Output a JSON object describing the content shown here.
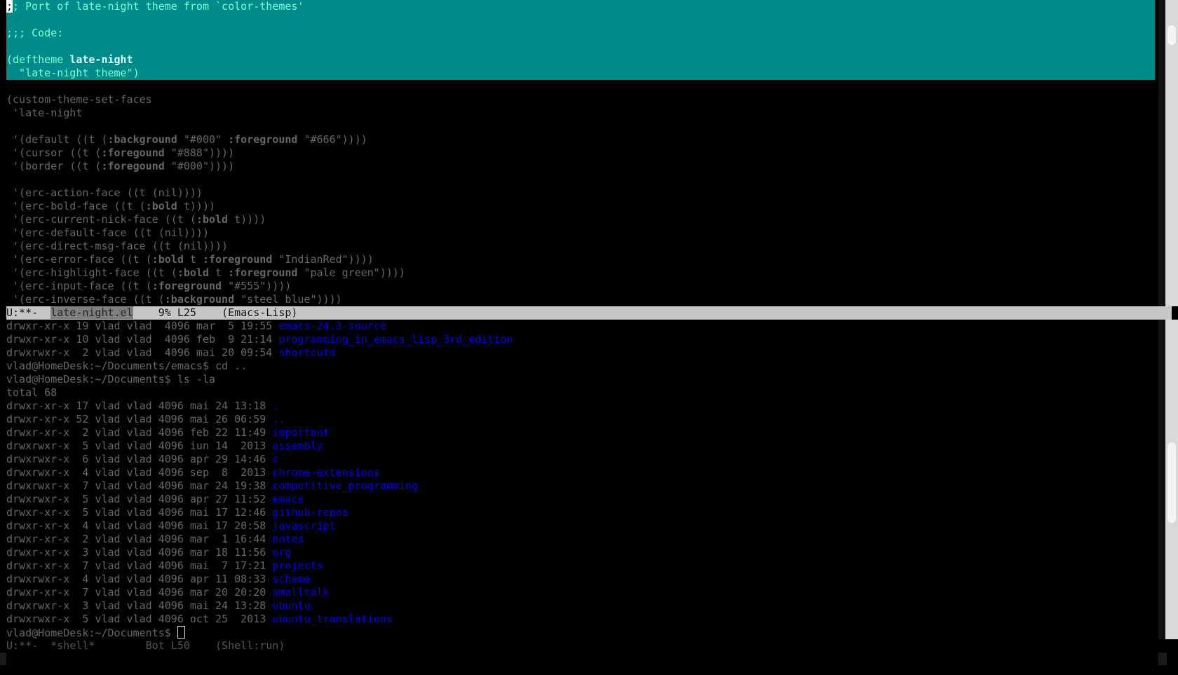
{
  "editor": {
    "selection_lines": {
      "l1_rest": "; Port of late-night theme from `color-themes'",
      "l1_point": ";",
      "l2": ";;; Code:",
      "l3_pre": "(deftheme ",
      "l3_name": "late-night",
      "l4": "  \"late-night theme\")"
    },
    "code": {
      "c1": "(custom-theme-set-faces",
      "c2": " 'late-night",
      "c3_a": " '(default ((t (",
      "c3_k1": ":background",
      "c3_b": " \"#000\" ",
      "c3_k2": ":foreground",
      "c3_c": " \"#666\"))))",
      "c4_a": " '(cursor ((t (",
      "c4_k": ":foregound",
      "c4_b": " \"#888\"))))",
      "c5_a": " '(border ((t (",
      "c5_k": ":foregound",
      "c5_b": " \"#000\"))))",
      "c6": " '(erc-action-face ((t (nil))))",
      "c7_a": " '(erc-bold-face ((t (",
      "c7_k": ":bold",
      "c7_b": " t))))",
      "c8_a": " '(erc-current-nick-face ((t (",
      "c8_k": ":bold",
      "c8_b": " t))))",
      "c9": " '(erc-default-face ((t (nil))))",
      "c10": " '(erc-direct-msg-face ((t (nil))))",
      "c11_a": " '(erc-error-face ((t (",
      "c11_k1": ":bold",
      "c11_b": " t ",
      "c11_k2": ":foreground",
      "c11_c": " \"IndianRed\"))))",
      "c12_a": " '(erc-highlight-face ((t (",
      "c12_k1": ":bold",
      "c12_b": " t ",
      "c12_k2": ":foreground",
      "c12_c": " \"pale green\"))))",
      "c13_a": " '(erc-input-face ((t (",
      "c13_k": ":foreground",
      "c13_b": " \"#555\"))))",
      "c14_a": " '(erc-inverse-face ((t (",
      "c14_k": ":background",
      "c14_b": " \"steel blue\"))))"
    },
    "modeline": {
      "state": "U:**-  ",
      "buffer": "late-night.el",
      "rest": "    9% L25    (Emacs-Lisp)"
    }
  },
  "shell": {
    "lines": [
      {
        "meta": "drwxr-xr-x 19 vlad vlad  4096 mar  5 19:55 ",
        "name": "emacs-24.3-source"
      },
      {
        "meta": "drwxr-xr-x 10 vlad vlad  4096 feb  9 21:14 ",
        "name": "programming_in_emacs_lisp_3rd_edition"
      },
      {
        "meta": "drwxrwxr-x  2 vlad vlad  4096 mai 20 09:54 ",
        "name": "shortcuts"
      }
    ],
    "cmd1": "vlad@HomeDesk:~/Documents/emacs$ cd ..",
    "cmd2": "vlad@HomeDesk:~/Documents$ ls -la",
    "total": "total 68",
    "listing": [
      {
        "meta": "drwxr-xr-x 17 vlad vlad 4096 mai 24 13:18 ",
        "name": "."
      },
      {
        "meta": "drwxr-xr-x 52 vlad vlad 4096 mai 26 06:59 ",
        "name": ".."
      },
      {
        "meta": "drwxr-xr-x  2 vlad vlad 4096 feb 22 11:49 ",
        "name": "important"
      },
      {
        "meta": "drwxrwxr-x  5 vlad vlad 4096 iun 14  2013 ",
        "name": "assembly"
      },
      {
        "meta": "drwxrwxr-x  6 vlad vlad 4096 apr 29 14:46 ",
        "name": "c"
      },
      {
        "meta": "drwxrwxr-x  4 vlad vlad 4096 sep  8  2013 ",
        "name": "chrome-extensions"
      },
      {
        "meta": "drwxrwxr-x  7 vlad vlad 4096 mar 24 19:38 ",
        "name": "competitive_programming"
      },
      {
        "meta": "drwxrwxr-x  5 vlad vlad 4096 apr 27 11:52 ",
        "name": "emacs"
      },
      {
        "meta": "drwxr-xr-x  5 vlad vlad 4096 mai 17 12:46 ",
        "name": "github-repos"
      },
      {
        "meta": "drwxr-xr-x  4 vlad vlad 4096 mai 17 20:58 ",
        "name": "javascript"
      },
      {
        "meta": "drwxr-xr-x  2 vlad vlad 4096 mar  1 16:44 ",
        "name": "notes"
      },
      {
        "meta": "drwxr-xr-x  3 vlad vlad 4096 mar 18 11:56 ",
        "name": "org"
      },
      {
        "meta": "drwxr-xr-x  7 vlad vlad 4096 mai  7 17:21 ",
        "name": "projects"
      },
      {
        "meta": "drwxrwxr-x  4 vlad vlad 4096 apr 11 08:33 ",
        "name": "scheme"
      },
      {
        "meta": "drwxr-xr-x  7 vlad vlad 4096 mar 20 20:20 ",
        "name": "smalltalk"
      },
      {
        "meta": "drwxrwxr-x  3 vlad vlad 4096 mai 24 13:28 ",
        "name": "ubuntu"
      },
      {
        "meta": "drwxrwxr-x  5 vlad vlad 4096 oct 25  2013 ",
        "name": "ubuntu_translations"
      }
    ],
    "prompt": "vlad@HomeDesk:~/Documents$ ",
    "modeline": "U:**-  *shell*        Bot L50    (Shell:run)"
  }
}
